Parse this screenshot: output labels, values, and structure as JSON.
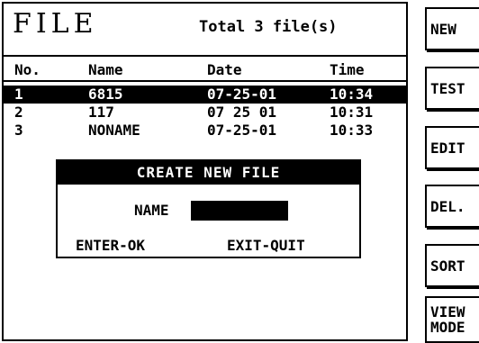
{
  "header": {
    "title": "FILE",
    "total": "Total 3 file(s)"
  },
  "table": {
    "columns": [
      "No.",
      "Name",
      "Date",
      "Time"
    ],
    "rows": [
      {
        "no": "1",
        "name": "6815",
        "date": "07-25-01",
        "time": "10:34",
        "selected": true
      },
      {
        "no": "2",
        "name": "117",
        "date": "07 25 01",
        "time": "10:31",
        "selected": false
      },
      {
        "no": "3",
        "name": "NONAME",
        "date": "07-25-01",
        "time": "10:33",
        "selected": false
      }
    ]
  },
  "dialog": {
    "title": "CREATE NEW FILE",
    "name_label": "NAME",
    "name_value": "",
    "enter_label": "ENTER-OK",
    "exit_label": "EXIT-QUIT"
  },
  "softkeys": [
    {
      "id": "new",
      "lines": [
        "NEW"
      ]
    },
    {
      "id": "test",
      "lines": [
        "TEST"
      ]
    },
    {
      "id": "edit",
      "lines": [
        "EDIT"
      ]
    },
    {
      "id": "del",
      "lines": [
        "DEL."
      ]
    },
    {
      "id": "sort",
      "lines": [
        "SORT"
      ]
    },
    {
      "id": "view-mode",
      "lines": [
        "VIEW",
        "MODE"
      ]
    }
  ]
}
